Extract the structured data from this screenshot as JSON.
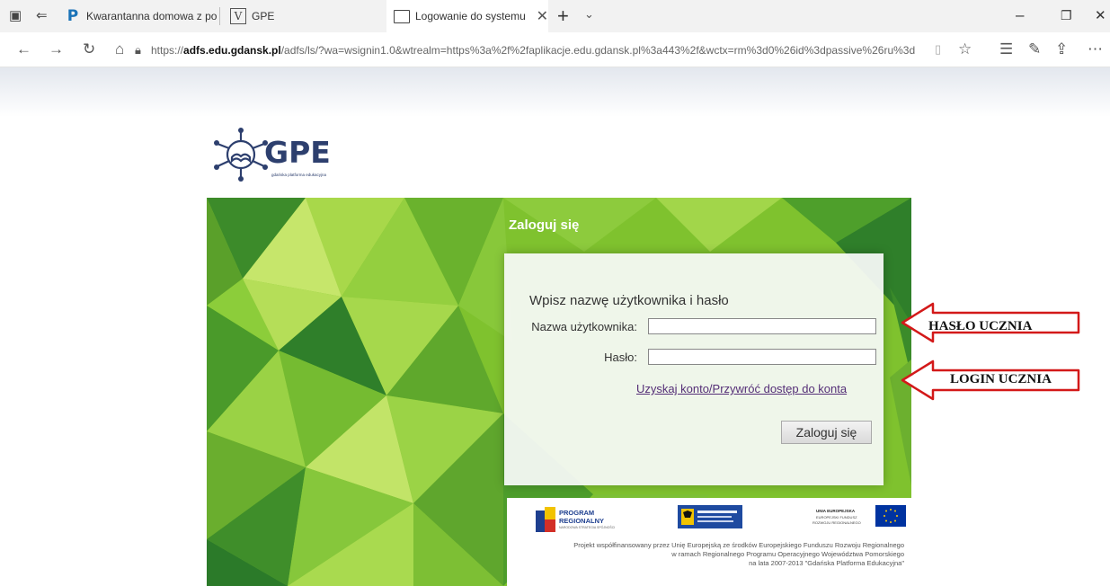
{
  "browser": {
    "tabs": [
      {
        "title": "Kwarantanna domowa z po",
        "icon": "pz-icon",
        "active": false
      },
      {
        "title": "GPE",
        "icon": "v-page-icon",
        "active": false
      },
      {
        "title": "Logowanie do systemu",
        "icon": "page-icon",
        "active": true
      }
    ],
    "window_controls": {
      "minimize": "–",
      "maximize": "❐",
      "close": "✕"
    },
    "url": {
      "prefix": "https://",
      "host": "adfs.edu.gdansk.pl",
      "path": "/adfs/ls/?wa=wsignin1.0&wtrealm=https%3a%2f%2faplikacje.edu.gdansk.pl%3a443%2f&wctx=rm%3d0%26id%3dpassive%26ru%3d"
    }
  },
  "logo": {
    "text": "GPE",
    "subtitle": "gdańska platforma edukacyjna",
    "brand_color": "#2d3f6e"
  },
  "login": {
    "title": "Zaloguj się",
    "heading": "Wpisz nazwę użytkownika i hasło",
    "username_label": "Nazwa użytkownika:",
    "username_value": "",
    "password_label": "Hasło:",
    "password_value": "",
    "link_text": "Uzyskaj konto/Przywróć dostęp do konta",
    "submit_label": "Zaloguj się"
  },
  "footer": {
    "program_name": "PROGRAM",
    "program_name_2": "REGIONALNY",
    "program_sub": "NARODOWA STRATEGIA SPÓJNOŚCI",
    "eu_name": "UNIA EUROPEJSKA",
    "eu_sub": "EUROPEJSKI FUNDUSZ",
    "eu_sub_2": "ROZWOJU REGIONALNEGO",
    "funding_text_1": "Projekt współfinansowany przez Unię Europejską ze środków Europejskiego Funduszu Rozwoju Regionalnego",
    "funding_text_2": "w ramach Regionalnego Programu Operacyjnego Województwa Pomorskiego",
    "funding_text_3": "na lata 2007-2013 \"Gdańska Platforma Edukacyjna\""
  },
  "annotations": {
    "arrow_1": "HASŁO UCZNIA",
    "arrow_2": "LOGIN UCZNIA",
    "arrow_color": "#d31919"
  },
  "colors": {
    "banner_green": "#7fc22e",
    "link": "#552f77"
  }
}
